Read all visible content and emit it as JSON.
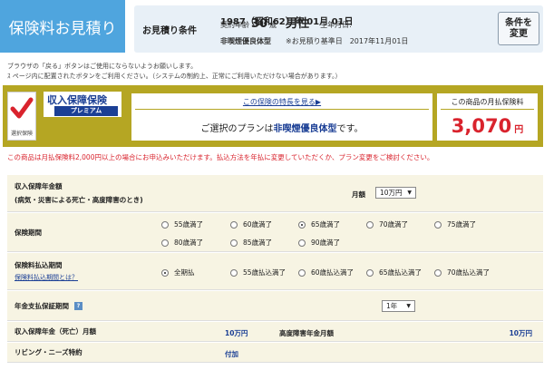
{
  "header": {
    "title": "保険料お見積り",
    "conditions_label": "お見積り条件",
    "age_label": "契約年齢",
    "age_value": "30",
    "age_unit": "歳",
    "gender": "男性",
    "birth_label": "生年月日:",
    "birth_value": "1987（昭和62）年 01月 01日",
    "type": "非喫煙優良体型",
    "base_date": "※お見積り基準日　2017年11月01日",
    "change_button": "条件を変更"
  },
  "notes": [
    "ブラウザの「戻る」ボタンはご使用にならないようお願いします。",
    "ｽ ページ内に配置されたボタンをご利用ください。（システムの制約上、正常にご利用いただけない場合があります。）"
  ],
  "plan": {
    "check_label": "選択保険",
    "name": "収入保障保険",
    "premium": "プレミアム",
    "features_link": "この保険の特長を見る▶",
    "desc_prefix": "ご選択のプランは",
    "desc_type": "非喫煙優良体型",
    "desc_suffix": "です。",
    "price_header": "この商品の月払保険料",
    "price": "3,070",
    "price_unit": "円"
  },
  "warning": "この商品は月払保険料2,000円以上の場合にお申込みいただけます。払込方法を年払に変更していただくか、プラン変更をご検討ください。",
  "rows": {
    "income": {
      "label_1": "収入保障年金額",
      "label_2": "(病気・災害による死亡・高度障害のとき)",
      "monthly_label": "月額",
      "monthly_value": "10万円"
    },
    "period": {
      "label": "保険期間",
      "options": [
        "55歳満了",
        "60歳満了",
        "65歳満了",
        "70歳満了",
        "75歳満了",
        "80歳満了",
        "85歳満了",
        "90歳満了"
      ],
      "selected": "65歳満了"
    },
    "payment": {
      "label": "保険料払込期間",
      "link": "保険料払込期間とは？",
      "options": [
        "全期払",
        "55歳払込満了",
        "60歳払込満了",
        "65歳払込満了",
        "70歳払込満了"
      ],
      "selected": "全期払"
    },
    "guarantee": {
      "label": "年金支払保証期間",
      "help": "?",
      "value": "1年"
    },
    "pension": {
      "label": "収入保障年金（死亡）月額",
      "value": "10万円",
      "label2": "高度障害年金月額",
      "value2": "10万円"
    },
    "living": {
      "label": "リビング・ニーズ特約",
      "value": "付加"
    }
  }
}
